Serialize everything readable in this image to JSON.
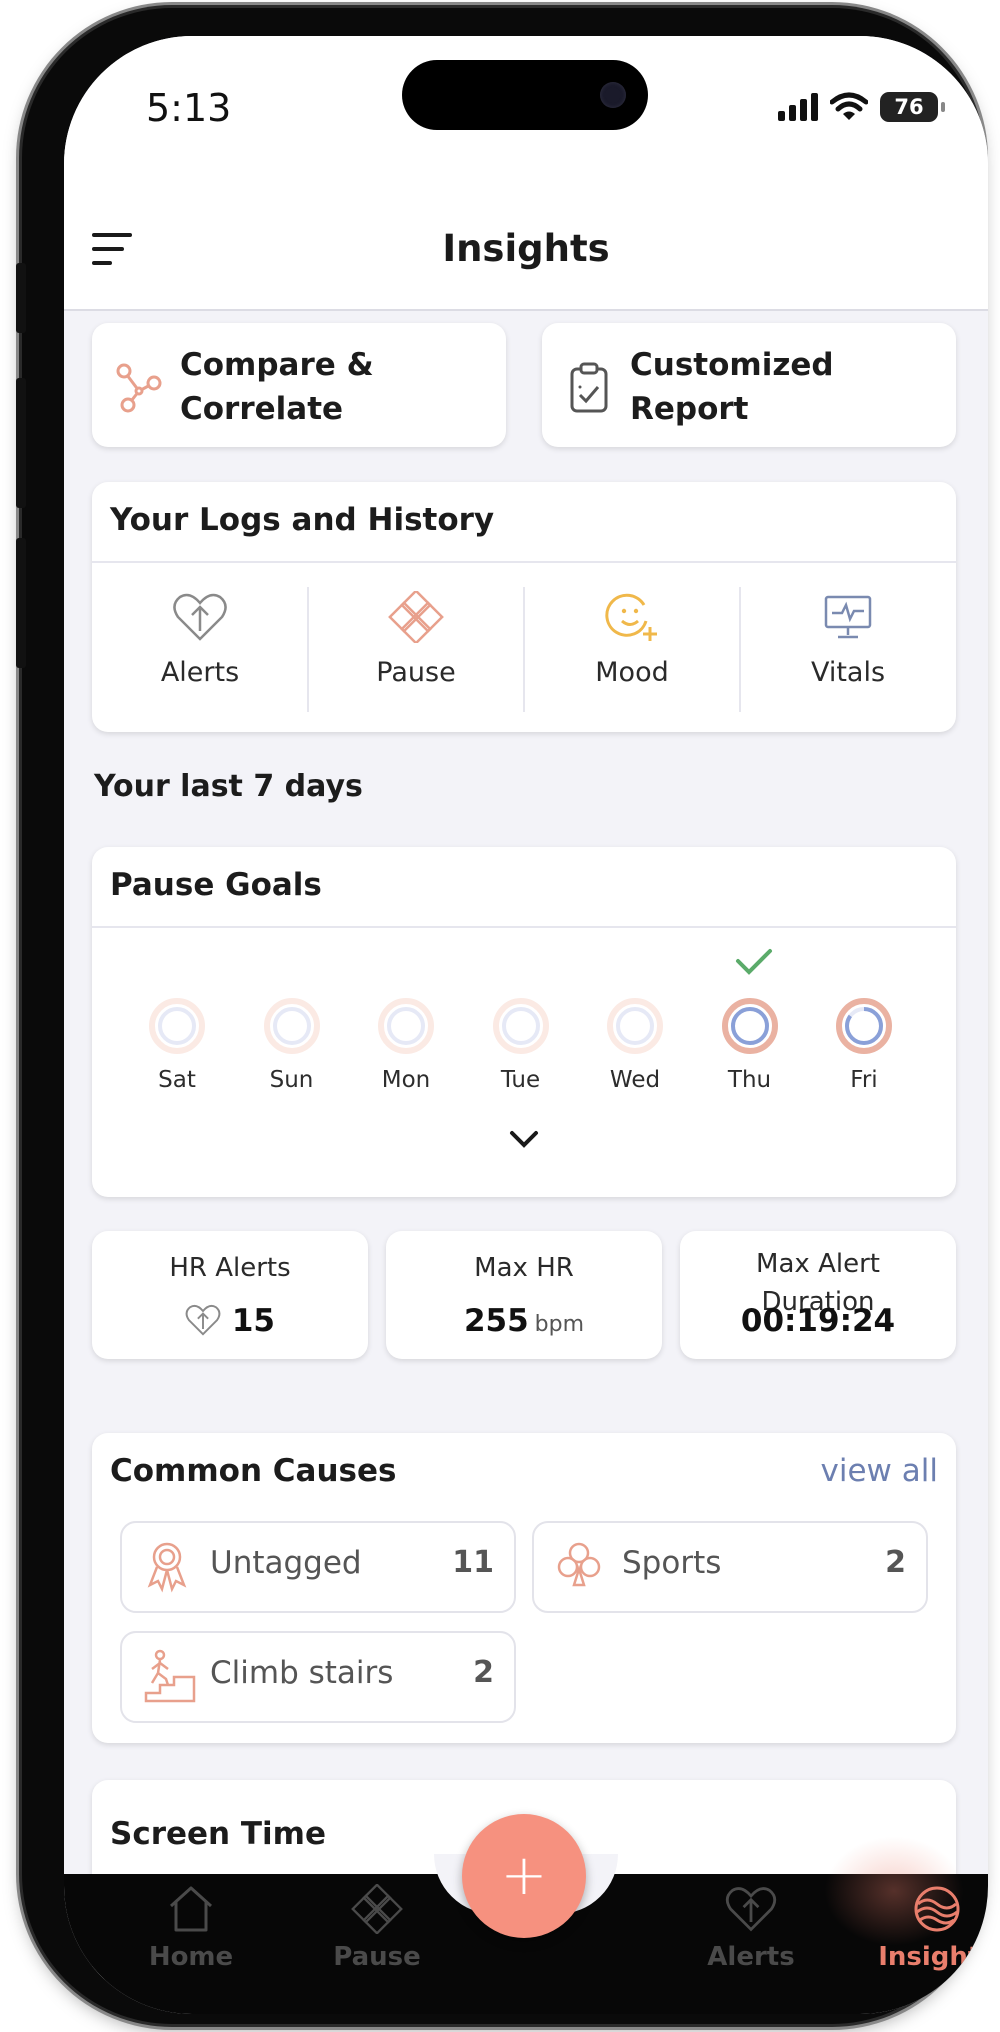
{
  "status_bar": {
    "time": "5:13",
    "battery": "76"
  },
  "header": {
    "title": "Insights"
  },
  "quick_actions": [
    {
      "label": "Compare &\nCorrelate",
      "icon": "nodes-icon"
    },
    {
      "label": "Customized\nReport",
      "icon": "clipboard-check-icon"
    }
  ],
  "logs": {
    "title": "Your Logs and History",
    "items": [
      {
        "label": "Alerts",
        "icon": "heart-arrow-icon"
      },
      {
        "label": "Pause",
        "icon": "flower-icon"
      },
      {
        "label": "Mood",
        "icon": "smiley-plus-icon"
      },
      {
        "label": "Vitals",
        "icon": "monitor-pulse-icon"
      }
    ]
  },
  "last7": {
    "heading": "Your last 7 days"
  },
  "pause_goals": {
    "title": "Pause Goals",
    "days": [
      {
        "label": "Sat",
        "progress": 0,
        "completed": false
      },
      {
        "label": "Sun",
        "progress": 0,
        "completed": false
      },
      {
        "label": "Mon",
        "progress": 0,
        "completed": false
      },
      {
        "label": "Tue",
        "progress": 0,
        "completed": false
      },
      {
        "label": "Wed",
        "progress": 0,
        "completed": false
      },
      {
        "label": "Thu",
        "progress": 1.0,
        "completed": true
      },
      {
        "label": "Fri",
        "progress": 0.85,
        "completed": false
      }
    ]
  },
  "stats": [
    {
      "label": "HR Alerts",
      "value": "15",
      "unit": ""
    },
    {
      "label": "Max HR",
      "value": "255",
      "unit": "bpm"
    },
    {
      "label": "Max Alert\nDuration",
      "value": "00:19:24",
      "unit": ""
    }
  ],
  "common_causes": {
    "title": "Common Causes",
    "view_all": "view all",
    "items": [
      {
        "label": "Untagged",
        "count": "11",
        "icon": "ribbon-award-icon"
      },
      {
        "label": "Sports",
        "count": "2",
        "icon": "club-icon"
      },
      {
        "label": "Climb stairs",
        "count": "2",
        "icon": "stairs-icon"
      }
    ]
  },
  "screen_time": {
    "title": "Screen Time"
  },
  "fab": {
    "label": "+"
  },
  "nav": [
    {
      "label": "Home",
      "icon": "home-icon"
    },
    {
      "label": "Pause",
      "icon": "flower-icon"
    },
    {
      "label": "Alerts",
      "icon": "heart-arrow-icon"
    },
    {
      "label": "Insights",
      "icon": "waves-icon",
      "active": true
    }
  ],
  "colors": {
    "accent": "#f6917f",
    "ring": "#8aa0d8",
    "check": "#5bab6a",
    "link": "#6c7fb0"
  }
}
